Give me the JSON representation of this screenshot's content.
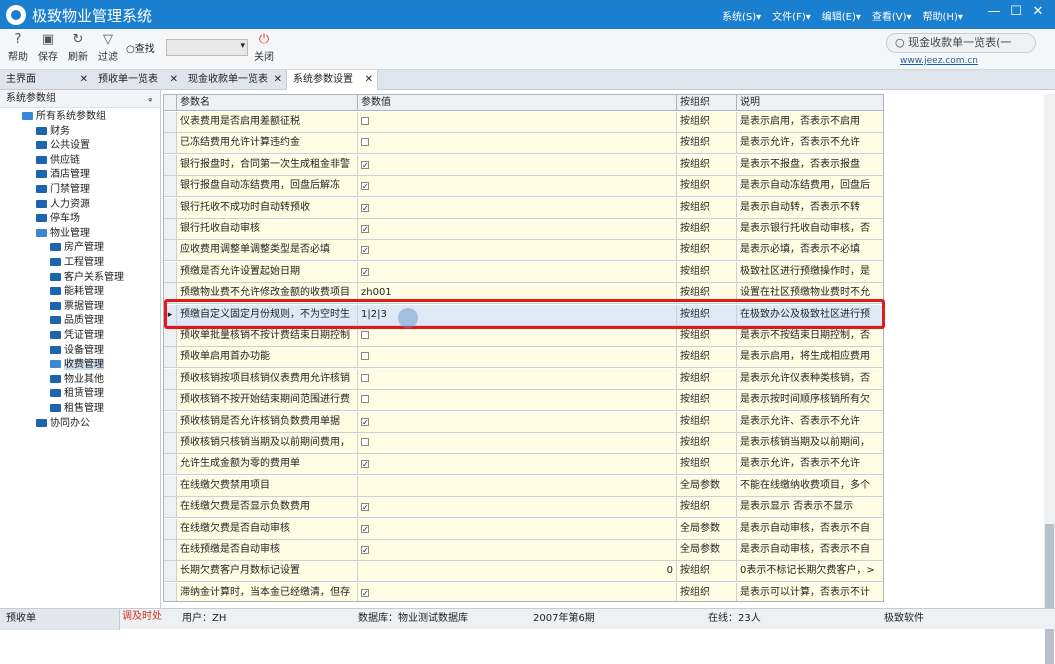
{
  "app": {
    "title": "极致物业管理系统"
  },
  "menu": [
    "系统(S)▾",
    "文件(F)▾",
    "编辑(E)▾",
    "查看(V)▾",
    "帮助(H)▾"
  ],
  "window_controls": [
    "—",
    "☐",
    "✕"
  ],
  "toolbar": {
    "buttons": [
      {
        "label": "帮助",
        "icon": "help-icon"
      },
      {
        "label": "保存",
        "icon": "save-icon"
      },
      {
        "label": "刷新",
        "icon": "refresh-icon"
      },
      {
        "label": "过滤",
        "icon": "filter-icon"
      }
    ],
    "find_label": "查找",
    "close_label": "关闭"
  },
  "search": {
    "value": "现金收款单一览表(一"
  },
  "website": "www.jeez.com.cn",
  "tabs": [
    "主界面",
    "预收单一览表",
    "现金收款单一览表",
    "系统参数设置"
  ],
  "left_panel": {
    "title": "系统参数组",
    "pin": "ᵩ",
    "tree": [
      {
        "label": "所有系统参数组",
        "level": 0
      },
      {
        "label": "财务",
        "level": 1
      },
      {
        "label": "公共设置",
        "level": 1
      },
      {
        "label": "供应链",
        "level": 1
      },
      {
        "label": "酒店管理",
        "level": 1
      },
      {
        "label": "门禁管理",
        "level": 1
      },
      {
        "label": "人力资源",
        "level": 1
      },
      {
        "label": "停车场",
        "level": 1
      },
      {
        "label": "物业管理",
        "level": 1
      },
      {
        "label": "房产管理",
        "level": 2
      },
      {
        "label": "工程管理",
        "level": 2
      },
      {
        "label": "客户关系管理",
        "level": 2
      },
      {
        "label": "能耗管理",
        "level": 2
      },
      {
        "label": "票据管理",
        "level": 2
      },
      {
        "label": "品质管理",
        "level": 2
      },
      {
        "label": "凭证管理",
        "level": 2
      },
      {
        "label": "设备管理",
        "level": 2
      },
      {
        "label": "收费管理",
        "level": 2
      },
      {
        "label": "物业其他",
        "level": 2
      },
      {
        "label": "租赁管理",
        "level": 2
      },
      {
        "label": "租售管理",
        "level": 2
      },
      {
        "label": "协同办公",
        "level": 1
      }
    ]
  },
  "grid": {
    "headers": [
      "参数名",
      "参数值",
      "按组织",
      "说明"
    ],
    "rows": [
      {
        "name": "仪表费用是否启用差额征税",
        "checkbox": true,
        "checked": false,
        "scope": "按组织",
        "desc": "是表示启用，否表示不启用"
      },
      {
        "name": "已冻结费用允许计算违约金",
        "checkbox": true,
        "checked": false,
        "scope": "按组织",
        "desc": "是表示允许，否表示不允许"
      },
      {
        "name": "银行报盘时，合同第一次生成租金非警",
        "checkbox": true,
        "checked": true,
        "scope": "按组织",
        "desc": "是表示不报盘，否表示报盘"
      },
      {
        "name": "银行报盘自动冻结费用，回盘后解冻",
        "checkbox": true,
        "checked": true,
        "scope": "按组织",
        "desc": "是表示自动冻结费用，回盘后"
      },
      {
        "name": "银行托收不成功时自动转预收",
        "checkbox": true,
        "checked": true,
        "scope": "按组织",
        "desc": "是表示自动转，否表示不转"
      },
      {
        "name": "银行托收自动审核",
        "checkbox": true,
        "checked": true,
        "scope": "按组织",
        "desc": "是表示银行托收自动审核，否"
      },
      {
        "name": "应收费用调整单调整类型是否必填",
        "checkbox": true,
        "checked": true,
        "scope": "按组织",
        "desc": "是表示必填，否表示不必填"
      },
      {
        "name": "预缴是否允许设置起始日期",
        "checkbox": true,
        "checked": true,
        "scope": "按组织",
        "desc": "极致社区进行预缴操作时，是"
      },
      {
        "name": "预缴物业费不允许修改金额的收费项目",
        "value": "zh001",
        "scope": "按组织",
        "desc": "设置在社区预缴物业费时不允"
      },
      {
        "name": "预缴自定义固定月份规则，不为空时生",
        "value": "1|2|3",
        "scope": "按组织",
        "desc": "在极致办公及极致社区进行预",
        "selected": true
      },
      {
        "name": "预收单批量核销不按计费结束日期控制",
        "checkbox": true,
        "checked": false,
        "scope": "按组织",
        "desc": "是表示不按结束日期控制，否"
      },
      {
        "name": "预收单启用首办功能",
        "checkbox": true,
        "checked": false,
        "scope": "按组织",
        "desc": "是表示启用，将生成相应费用"
      },
      {
        "name": "预收核销按项目核销仪表费用允许核销",
        "checkbox": true,
        "checked": false,
        "scope": "按组织",
        "desc": "是表示允许仪表种类核销，否"
      },
      {
        "name": "预收核销不按开始结束期间范围进行费",
        "checkbox": true,
        "checked": false,
        "scope": "按组织",
        "desc": "是表示按时间顺序核销所有欠"
      },
      {
        "name": "预收核销是否允许核销负数费用单据",
        "checkbox": true,
        "checked": true,
        "scope": "按组织",
        "desc": "是表示允许、否表示不允许"
      },
      {
        "name": "预收核销只核销当期及以前期间费用，",
        "checkbox": true,
        "checked": false,
        "scope": "按组织",
        "desc": "是表示核销当期及以前期间，"
      },
      {
        "name": "允许生成金额为零的费用单",
        "checkbox": true,
        "checked": true,
        "scope": "按组织",
        "desc": "是表示允许，否表示不允许"
      },
      {
        "name": "在线缴欠费禁用项目",
        "value": "",
        "scope": "全局参数",
        "desc": "不能在线缴纳收费项目，多个"
      },
      {
        "name": "在线缴欠费是否显示负数费用",
        "checkbox": true,
        "checked": true,
        "scope": "按组织",
        "desc": "是表示显示 否表示不显示"
      },
      {
        "name": "在线缴欠费是否自动审核",
        "checkbox": true,
        "checked": true,
        "scope": "全局参数",
        "desc": "是表示自动审核，否表示不自"
      },
      {
        "name": "在线预缴是否自动审核",
        "checkbox": true,
        "checked": true,
        "scope": "全局参数",
        "desc": "是表示自动审核，否表示不自"
      },
      {
        "name": "长期欠费客户月数标记设置",
        "value": "0",
        "numeric": true,
        "scope": "按组织",
        "desc": "0表示不标记长期欠费客户，>"
      },
      {
        "name": "滞纳金计算时，当本金已经缴清，但存",
        "checkbox": true,
        "checked": true,
        "scope": "按组织",
        "desc": "是表示可以计算，否表示不计"
      }
    ]
  },
  "status": {
    "left": "预收单",
    "left_red": "调及时处",
    "user": "用户：ZH",
    "database": "数据库：物业测试数据库",
    "period": "2007年第6期",
    "online": "在线：23人",
    "company": "极致软件"
  },
  "colors": {
    "titlebar": "#1a7fcf",
    "highlight": "#e0191c",
    "cell_bg": "#fefde3"
  }
}
